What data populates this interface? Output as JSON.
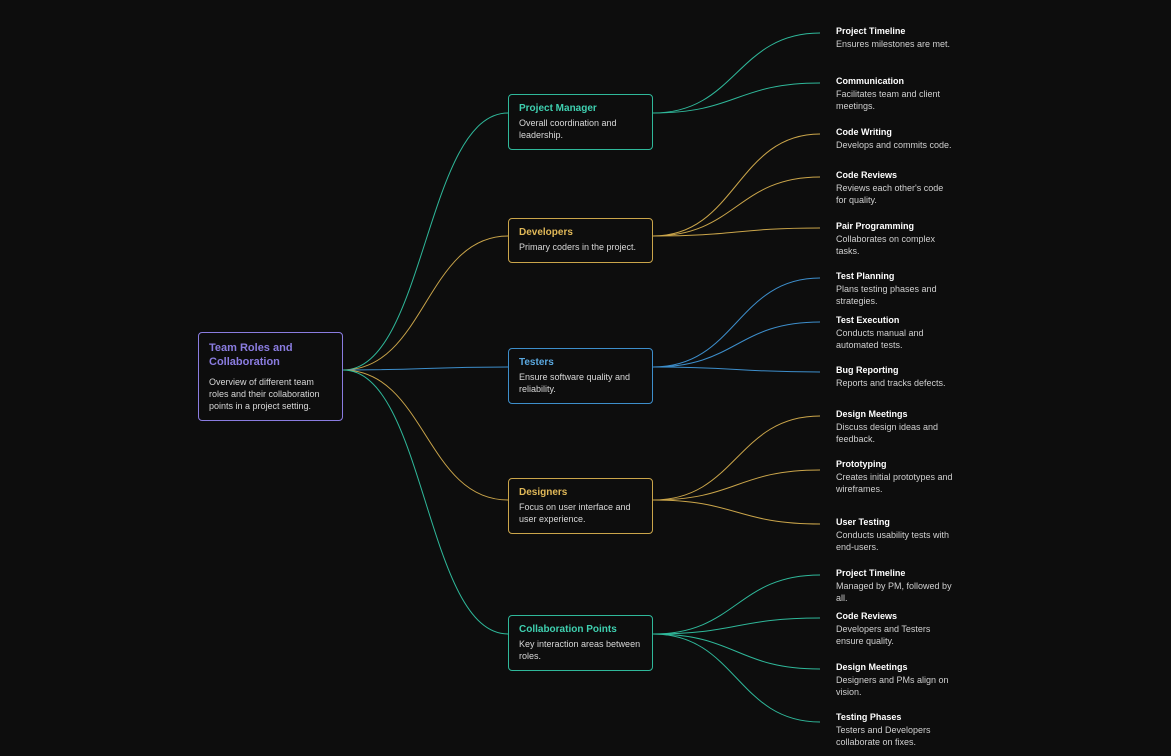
{
  "root": {
    "title": "Team Roles and Collaboration",
    "desc": "Overview of different team roles and their collaboration points in a project setting."
  },
  "branches": [
    {
      "key": "pm",
      "title": "Project Manager",
      "desc": "Overall coordination and leadership.",
      "color": "#2fb89a",
      "leaves": [
        {
          "title": "Project Timeline",
          "desc": "Ensures milestones are met."
        },
        {
          "title": "Communication",
          "desc": "Facilitates team and client meetings."
        }
      ]
    },
    {
      "key": "dev",
      "title": "Developers",
      "desc": "Primary coders in the project.",
      "color": "#caa54a",
      "leaves": [
        {
          "title": "Code Writing",
          "desc": "Develops and commits code."
        },
        {
          "title": "Code Reviews",
          "desc": "Reviews each other's code for quality."
        },
        {
          "title": "Pair Programming",
          "desc": "Collaborates on complex tasks."
        }
      ]
    },
    {
      "key": "test",
      "title": "Testers",
      "desc": "Ensure software quality and reliability.",
      "color": "#3d8ecb",
      "leaves": [
        {
          "title": "Test Planning",
          "desc": "Plans testing phases and strategies."
        },
        {
          "title": "Test Execution",
          "desc": "Conducts manual and automated tests."
        },
        {
          "title": "Bug Reporting",
          "desc": "Reports and tracks defects."
        }
      ]
    },
    {
      "key": "des",
      "title": "Designers",
      "desc": "Focus on user interface and user experience.",
      "color": "#caa54a",
      "leaves": [
        {
          "title": "Design Meetings",
          "desc": "Discuss design ideas and feedback."
        },
        {
          "title": "Prototyping",
          "desc": "Creates initial prototypes and wireframes."
        },
        {
          "title": "User Testing",
          "desc": "Conducts usability tests with end-users."
        }
      ]
    },
    {
      "key": "collab",
      "title": "Collaboration Points",
      "desc": "Key interaction areas between roles.",
      "color": "#2fb89a",
      "leaves": [
        {
          "title": "Project Timeline",
          "desc": "Managed by PM, followed by all."
        },
        {
          "title": "Code Reviews",
          "desc": "Developers and Testers ensure quality."
        },
        {
          "title": "Design Meetings",
          "desc": "Designers and PMs align on vision."
        },
        {
          "title": "Testing Phases",
          "desc": "Testers and Developers collaborate on fixes."
        }
      ]
    }
  ]
}
